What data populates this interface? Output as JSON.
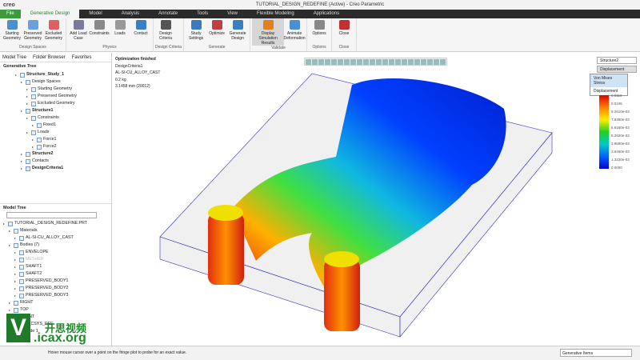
{
  "app": {
    "logo": "creo",
    "title": "TUTORIAL_DESIGN_REDEFINE (Active) - Creo Parametric"
  },
  "tabs": [
    "File",
    "Generative Design",
    "Model",
    "Analysis",
    "Annotate",
    "Tools",
    "View",
    "Flexible Modeling",
    "Applications"
  ],
  "ribbon": [
    {
      "label": "Design Spaces",
      "buttons": [
        "Starting Geometry",
        "Preserved Geometry",
        "Excluded Geometry"
      ]
    },
    {
      "label": "Physics",
      "buttons": [
        "Add Load Case",
        "Constraints",
        "Loads",
        "Contact"
      ]
    },
    {
      "label": "Design Criteria",
      "buttons": [
        "Design Criteria"
      ]
    },
    {
      "label": "Generate",
      "buttons": [
        "Study Settings",
        "Optimize",
        "Generate Design"
      ]
    },
    {
      "label": "Validate",
      "buttons": [
        "Display Simulation Results",
        "Animate Deformation"
      ]
    },
    {
      "label": "Options",
      "buttons": [
        "Options"
      ]
    },
    {
      "label": "Close",
      "buttons": [
        "Close"
      ]
    }
  ],
  "panel_tabs": [
    "Model Tree",
    "Folder Browser",
    "Favorites"
  ],
  "generative_tree": {
    "title": "Generative Tree",
    "items": [
      {
        "t": "Structure_Study_1",
        "l": 1
      },
      {
        "t": "Design Spaces",
        "l": 2
      },
      {
        "t": "Starting Geometry",
        "l": 3
      },
      {
        "t": "Preserved Geometry",
        "l": 3
      },
      {
        "t": "Excluded Geometry",
        "l": 3
      },
      {
        "t": "Structure1",
        "l": 2
      },
      {
        "t": "Constraints",
        "l": 3
      },
      {
        "t": "Fixed1",
        "l": 4
      },
      {
        "t": "Loads",
        "l": 3
      },
      {
        "t": "Force1",
        "l": 4
      },
      {
        "t": "Force2",
        "l": 4
      },
      {
        "t": "Structure2",
        "l": 2
      },
      {
        "t": "Contacts",
        "l": 2
      },
      {
        "t": "DesignCriteria1",
        "l": 2
      }
    ]
  },
  "model_tree": {
    "title": "Model Tree",
    "items": [
      {
        "t": "TUTORIAL_DESIGN_REDEFINE.PRT",
        "l": 0
      },
      {
        "t": "Materials",
        "l": 1
      },
      {
        "t": "AL-SI-CU_ALLOY_CAST",
        "l": 2
      },
      {
        "t": "Bodies (7)",
        "l": 1
      },
      {
        "t": "ENVELOPE",
        "l": 2
      },
      {
        "t": "MESHER",
        "l": 2
      },
      {
        "t": "SHAFT1",
        "l": 2
      },
      {
        "t": "SHAFT2",
        "l": 2
      },
      {
        "t": "PRESERVED_BODY1",
        "l": 2
      },
      {
        "t": "PRESERVED_BODY2",
        "l": 2
      },
      {
        "t": "PRESERVED_BODY3",
        "l": 2
      },
      {
        "t": "RIGHT",
        "l": 1
      },
      {
        "t": "TOP",
        "l": 1
      },
      {
        "t": "FRONT",
        "l": 1
      },
      {
        "t": "PRT_CSYS_DEF",
        "l": 1
      },
      {
        "t": "Extrude 1",
        "l": 1
      }
    ]
  },
  "study_info": [
    "Optimization finished",
    "DesignCriteria1",
    "AL-SI-CU_ALLOY_CAST",
    "0.2 kg",
    "3.1458 mm (20012)"
  ],
  "results": {
    "study": "Structure2",
    "quantity": "Displacement",
    "options": [
      "Von Mises Stress",
      "Displacement"
    ],
    "legend": [
      "0.0119",
      "0.0106",
      "9.2610e-03",
      "7.9380e-03",
      "6.6150e-03",
      "5.2920e-03",
      "3.9690e-03",
      "2.6460e-03",
      "1.3230e-03",
      "0.0000"
    ]
  },
  "status": {
    "message": "Hover mouse cursor over a point on the fringe plot to probe for an exact value.",
    "filter": "Generative Items"
  },
  "watermark": {
    "cn": "开思视频",
    "url": ".icax.org"
  }
}
